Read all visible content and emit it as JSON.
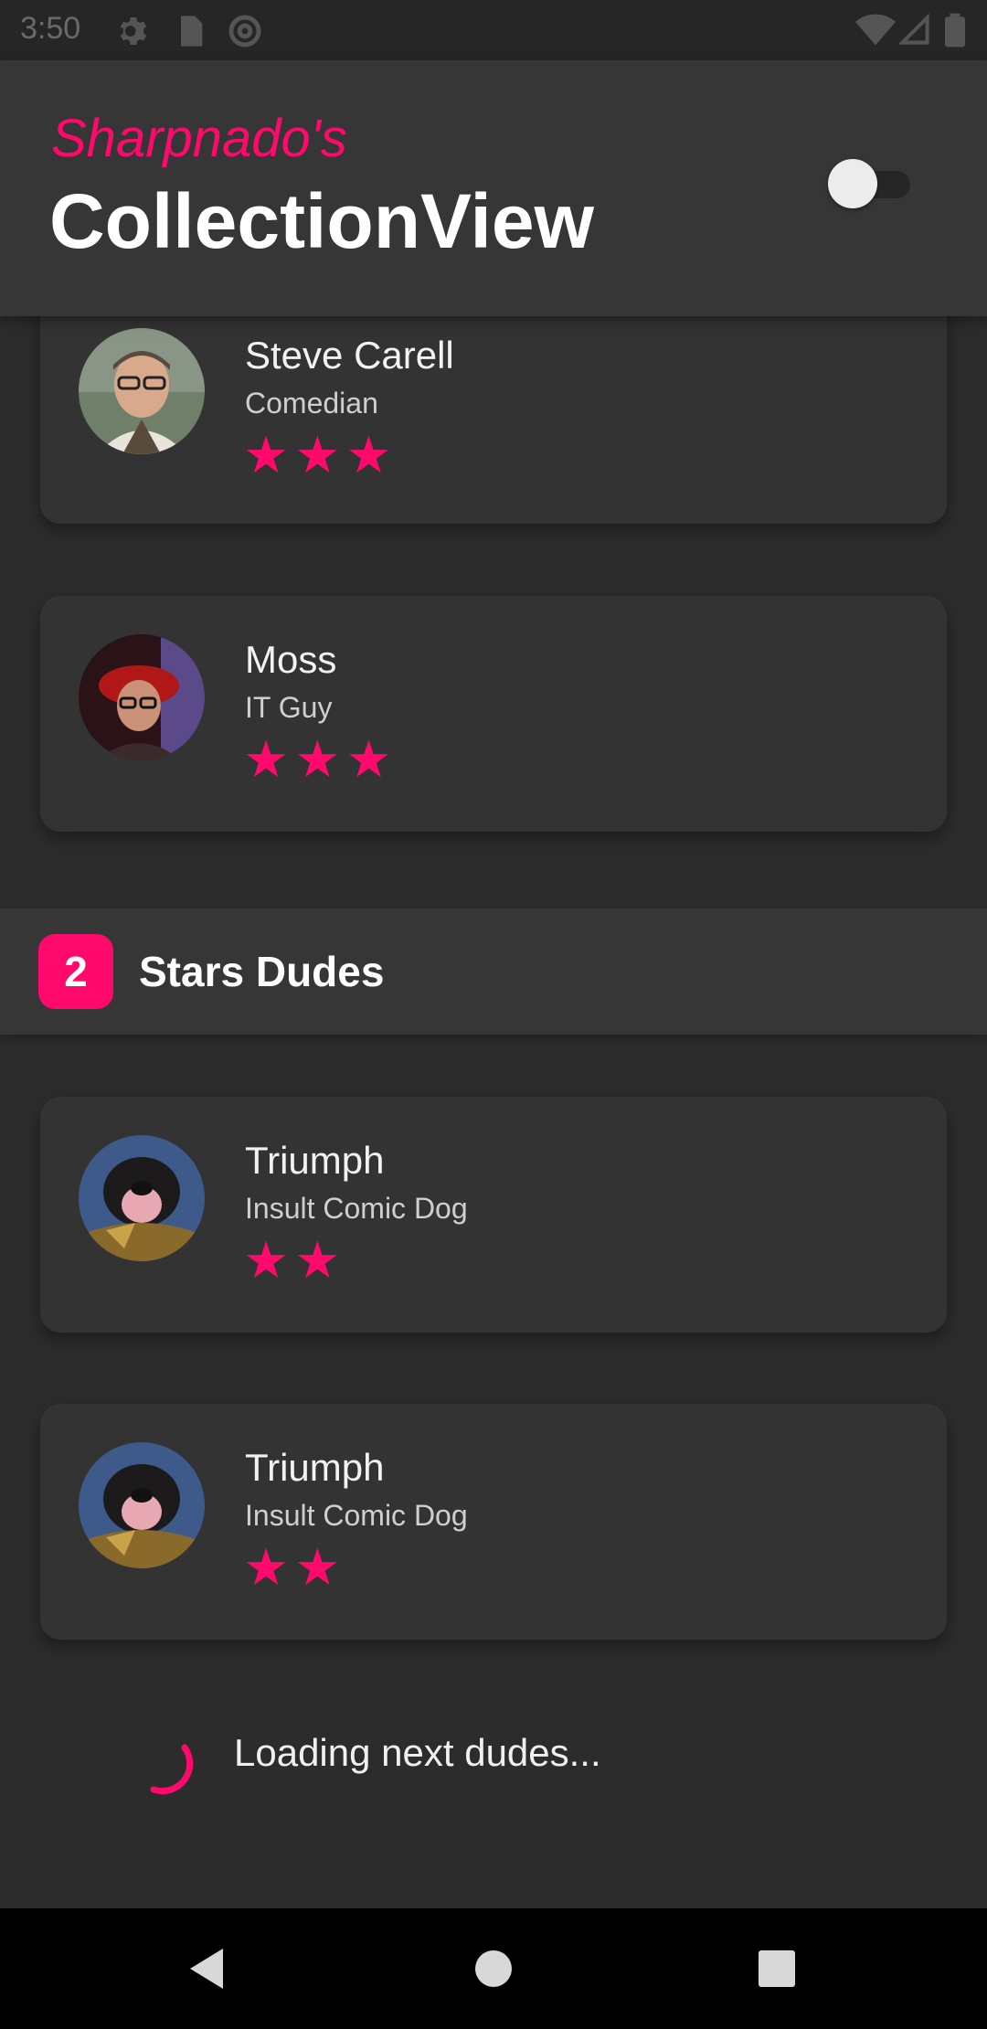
{
  "status_bar": {
    "time": "3:50",
    "left_icons": [
      "gear-icon",
      "sd-card-icon",
      "at-sign-icon"
    ],
    "right_icons": [
      "wifi-icon",
      "signal-icon",
      "battery-icon"
    ]
  },
  "header": {
    "subtitle": "Sharpnado's",
    "title": "CollectionView",
    "toggle_state": "off"
  },
  "colors": {
    "accent": "#ff0a6c",
    "background": "#2c2c2c",
    "card": "#333333",
    "header": "#363636"
  },
  "cards_top": [
    {
      "name": "Steve Carell",
      "role": "Comedian",
      "stars": "★★★",
      "star_count": 3
    },
    {
      "name": "Moss",
      "role": "IT Guy",
      "stars": "★★★",
      "star_count": 3
    }
  ],
  "section": {
    "badge": "2",
    "title": "Stars Dudes"
  },
  "cards_bottom": [
    {
      "name": "Triumph",
      "role": "Insult Comic Dog",
      "stars": "★★",
      "star_count": 2
    },
    {
      "name": "Triumph",
      "role": "Insult Comic Dog",
      "stars": "★★",
      "star_count": 2
    }
  ],
  "loading": {
    "text": "Loading next dudes..."
  },
  "nav_bar": {
    "buttons": [
      "back-icon",
      "home-icon",
      "recents-icon"
    ]
  }
}
